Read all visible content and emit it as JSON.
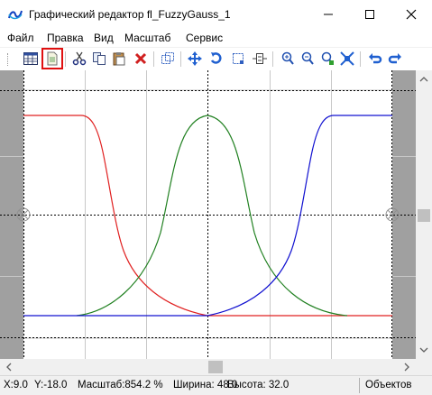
{
  "window": {
    "title": "Графический редактор fl_FuzzyGauss_1",
    "minimize_icon": "minimize-icon",
    "maximize_icon": "maximize-icon",
    "close_icon": "close-icon"
  },
  "menu": {
    "items": [
      "Файл",
      "Правка",
      "Вид",
      "Масштаб",
      "Сервис"
    ]
  },
  "toolbar": {
    "icons": [
      "table-icon",
      "document-icon",
      "cut-icon",
      "copy-icon",
      "paste-icon",
      "delete-icon",
      "select-area-icon",
      "move-icon",
      "rotate-icon",
      "select-rect-icon",
      "fit-icon",
      "zoom-in-icon",
      "zoom-out-icon",
      "zoom-green-icon",
      "zoom-fit-icon",
      "undo-icon",
      "redo-icon"
    ],
    "selected_index": 1
  },
  "status": {
    "x": "X:9.0",
    "y": "Y:-18.0",
    "scale": "Масштаб:854.2 %",
    "width": "Ширина: 48.0",
    "height": "Высота: 32.0",
    "objects": "Объектов"
  },
  "colors": {
    "series_red": "#e02020",
    "series_green": "#208020",
    "series_blue": "#1010d0",
    "selected_outline": "#e01010"
  }
}
